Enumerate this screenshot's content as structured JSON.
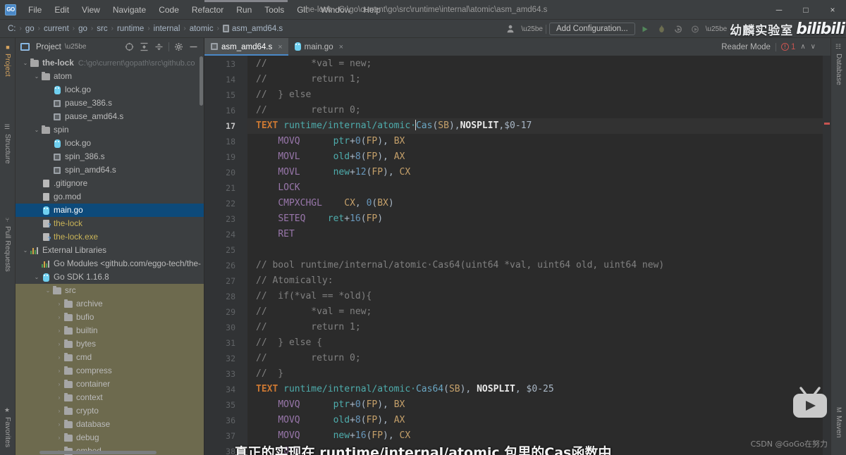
{
  "window": {
    "title": "the-lock - C:\\go\\current\\go\\src\\runtime\\internal\\atomic\\asm_amd64.s",
    "app_logo_text": "GO",
    "minimize": "─",
    "maximize": "□",
    "close": "×"
  },
  "menubar": {
    "items": [
      {
        "label": "File"
      },
      {
        "label": "Edit"
      },
      {
        "label": "View"
      },
      {
        "label": "Navigate"
      },
      {
        "label": "Code"
      },
      {
        "label": "Refactor"
      },
      {
        "label": "Run"
      },
      {
        "label": "Tools"
      },
      {
        "label": "Git"
      },
      {
        "label": "Window"
      },
      {
        "label": "Help"
      }
    ]
  },
  "navbar": {
    "breadcrumbs": [
      "C:",
      "go",
      "current",
      "go",
      "src",
      "runtime",
      "internal",
      "atomic",
      "asm_amd64.s"
    ],
    "separator": "›",
    "add_configuration": "Add Configuration...",
    "watermark_cn": "幼麟实验室",
    "bili_logo": "bilibili"
  },
  "left_strip": {
    "tools": [
      {
        "label": "Project",
        "active": true
      },
      {
        "label": "Structure",
        "active": false
      },
      {
        "label": "Pull Requests",
        "active": false
      },
      {
        "label": "Favorites",
        "active": false
      }
    ]
  },
  "right_strip": {
    "tools": [
      {
        "label": "Database"
      },
      {
        "label": "Maven"
      }
    ]
  },
  "project_panel": {
    "title": "Project",
    "tree": [
      {
        "indent": 0,
        "arrow": "⌄",
        "icon": "folder",
        "label": "the-lock",
        "sub": "C:\\go\\current\\gopath\\src\\github.co",
        "bold": true
      },
      {
        "indent": 1,
        "arrow": "⌄",
        "icon": "folder",
        "label": "atom"
      },
      {
        "indent": 2,
        "arrow": "",
        "icon": "gopher",
        "label": "lock.go"
      },
      {
        "indent": 2,
        "arrow": "",
        "icon": "asm",
        "label": "pause_386.s"
      },
      {
        "indent": 2,
        "arrow": "",
        "icon": "asm",
        "label": "pause_amd64.s"
      },
      {
        "indent": 1,
        "arrow": "⌄",
        "icon": "folder",
        "label": "spin"
      },
      {
        "indent": 2,
        "arrow": "",
        "icon": "gopher",
        "label": "lock.go"
      },
      {
        "indent": 2,
        "arrow": "",
        "icon": "asm",
        "label": "spin_386.s"
      },
      {
        "indent": 2,
        "arrow": "",
        "icon": "asm",
        "label": "spin_amd64.s"
      },
      {
        "indent": 1,
        "arrow": "",
        "icon": "file",
        "label": ".gitignore"
      },
      {
        "indent": 1,
        "arrow": "",
        "icon": "file",
        "label": "go.mod"
      },
      {
        "indent": 1,
        "arrow": "",
        "icon": "gopher",
        "label": "main.go",
        "selected": true
      },
      {
        "indent": 1,
        "arrow": "",
        "icon": "fileq",
        "label": "the-lock",
        "yellow": true
      },
      {
        "indent": 1,
        "arrow": "",
        "icon": "fileq",
        "label": "the-lock.exe",
        "yellow": true
      },
      {
        "indent": 0,
        "arrow": "⌄",
        "icon": "lib",
        "label": "External Libraries"
      },
      {
        "indent": 1,
        "arrow": "",
        "icon": "lib",
        "label": "Go Modules <github.com/eggo-tech/the-l"
      },
      {
        "indent": 1,
        "arrow": "⌄",
        "icon": "gopher",
        "label": "Go SDK 1.16.8"
      },
      {
        "indent": 2,
        "arrow": "⌄",
        "icon": "folder",
        "label": "src",
        "shaded": true
      },
      {
        "indent": 3,
        "arrow": "›",
        "icon": "folder",
        "label": "archive",
        "shaded": true
      },
      {
        "indent": 3,
        "arrow": "›",
        "icon": "folder",
        "label": "bufio",
        "shaded": true
      },
      {
        "indent": 3,
        "arrow": "›",
        "icon": "folder",
        "label": "builtin",
        "shaded": true
      },
      {
        "indent": 3,
        "arrow": "›",
        "icon": "folder",
        "label": "bytes",
        "shaded": true
      },
      {
        "indent": 3,
        "arrow": "›",
        "icon": "folder",
        "label": "cmd",
        "shaded": true
      },
      {
        "indent": 3,
        "arrow": "›",
        "icon": "folder",
        "label": "compress",
        "shaded": true
      },
      {
        "indent": 3,
        "arrow": "›",
        "icon": "folder",
        "label": "container",
        "shaded": true
      },
      {
        "indent": 3,
        "arrow": "›",
        "icon": "folder",
        "label": "context",
        "shaded": true
      },
      {
        "indent": 3,
        "arrow": "›",
        "icon": "folder",
        "label": "crypto",
        "shaded": true
      },
      {
        "indent": 3,
        "arrow": "›",
        "icon": "folder",
        "label": "database",
        "shaded": true
      },
      {
        "indent": 3,
        "arrow": "›",
        "icon": "folder",
        "label": "debug",
        "shaded": true
      },
      {
        "indent": 3,
        "arrow": "›",
        "icon": "folder",
        "label": "embed",
        "shaded": true
      }
    ]
  },
  "editor": {
    "tabs": [
      {
        "label": "asm_amd64.s",
        "icon": "asm-icon",
        "active": true,
        "close": "×"
      },
      {
        "label": "main.go",
        "icon": "gopher-icon",
        "active": false,
        "close": "×"
      }
    ],
    "reader_mode": "Reader Mode",
    "error_count": "1",
    "chevron_up": "∧",
    "chevron_down": "∨",
    "first_line_number": 13,
    "current_line": 17,
    "lines": [
      {
        "n": 13,
        "segs": [
          {
            "t": "//        *val = new;",
            "c": "cm"
          }
        ]
      },
      {
        "n": 14,
        "segs": [
          {
            "t": "//        return 1;",
            "c": "cm"
          }
        ]
      },
      {
        "n": 15,
        "segs": [
          {
            "t": "//  } else",
            "c": "cm"
          }
        ]
      },
      {
        "n": 16,
        "segs": [
          {
            "t": "//        return 0;",
            "c": "cm"
          }
        ]
      },
      {
        "n": 17,
        "cur": true,
        "segs": [
          {
            "t": "TEXT",
            "c": "kw-text"
          },
          {
            "t": " ",
            "c": "plain"
          },
          {
            "t": "runtime∕internal∕atomic·",
            "c": "sym"
          },
          {
            "t": "|",
            "c": "caret"
          },
          {
            "t": "Cas",
            "c": "fn"
          },
          {
            "t": "(",
            "c": "plain"
          },
          {
            "t": "SB",
            "c": "reg2"
          },
          {
            "t": "),",
            "c": "plain"
          },
          {
            "t": "NOSPLIT",
            "c": "bold-w"
          },
          {
            "t": ",",
            "c": "plain"
          },
          {
            "t": "$0-17",
            "c": "plain"
          }
        ]
      },
      {
        "n": 18,
        "segs": [
          {
            "t": "    ",
            "c": "plain"
          },
          {
            "t": "MOVQ",
            "c": "reg"
          },
          {
            "t": "      ",
            "c": "plain"
          },
          {
            "t": "ptr",
            "c": "ident"
          },
          {
            "t": "+",
            "c": "plain"
          },
          {
            "t": "0",
            "c": "num"
          },
          {
            "t": "(",
            "c": "plain"
          },
          {
            "t": "FP",
            "c": "reg2"
          },
          {
            "t": "), ",
            "c": "plain"
          },
          {
            "t": "BX",
            "c": "reg2"
          }
        ]
      },
      {
        "n": 19,
        "segs": [
          {
            "t": "    ",
            "c": "plain"
          },
          {
            "t": "MOVL",
            "c": "reg"
          },
          {
            "t": "      ",
            "c": "plain"
          },
          {
            "t": "old",
            "c": "ident"
          },
          {
            "t": "+",
            "c": "plain"
          },
          {
            "t": "8",
            "c": "num"
          },
          {
            "t": "(",
            "c": "plain"
          },
          {
            "t": "FP",
            "c": "reg2"
          },
          {
            "t": "), ",
            "c": "plain"
          },
          {
            "t": "AX",
            "c": "reg2"
          }
        ]
      },
      {
        "n": 20,
        "segs": [
          {
            "t": "    ",
            "c": "plain"
          },
          {
            "t": "MOVL",
            "c": "reg"
          },
          {
            "t": "      ",
            "c": "plain"
          },
          {
            "t": "new",
            "c": "ident"
          },
          {
            "t": "+",
            "c": "plain"
          },
          {
            "t": "12",
            "c": "num"
          },
          {
            "t": "(",
            "c": "plain"
          },
          {
            "t": "FP",
            "c": "reg2"
          },
          {
            "t": "), ",
            "c": "plain"
          },
          {
            "t": "CX",
            "c": "reg2"
          }
        ]
      },
      {
        "n": 21,
        "segs": [
          {
            "t": "    ",
            "c": "plain"
          },
          {
            "t": "LOCK",
            "c": "reg"
          }
        ]
      },
      {
        "n": 22,
        "segs": [
          {
            "t": "    ",
            "c": "plain"
          },
          {
            "t": "CMPXCHGL",
            "c": "reg"
          },
          {
            "t": "    ",
            "c": "plain"
          },
          {
            "t": "CX",
            "c": "reg2"
          },
          {
            "t": ", ",
            "c": "plain"
          },
          {
            "t": "0",
            "c": "num"
          },
          {
            "t": "(",
            "c": "plain"
          },
          {
            "t": "BX",
            "c": "reg2"
          },
          {
            "t": ")",
            "c": "plain"
          }
        ]
      },
      {
        "n": 23,
        "segs": [
          {
            "t": "    ",
            "c": "plain"
          },
          {
            "t": "SETEQ",
            "c": "reg"
          },
          {
            "t": "    ",
            "c": "plain"
          },
          {
            "t": "ret",
            "c": "ident"
          },
          {
            "t": "+",
            "c": "plain"
          },
          {
            "t": "16",
            "c": "num"
          },
          {
            "t": "(",
            "c": "plain"
          },
          {
            "t": "FP",
            "c": "reg2"
          },
          {
            "t": ")",
            "c": "plain"
          }
        ]
      },
      {
        "n": 24,
        "segs": [
          {
            "t": "    ",
            "c": "plain"
          },
          {
            "t": "RET",
            "c": "reg"
          }
        ]
      },
      {
        "n": 25,
        "segs": [
          {
            "t": "",
            "c": "plain"
          }
        ]
      },
      {
        "n": 26,
        "segs": [
          {
            "t": "// bool runtime∕internal∕atomic·Cas64(uint64 *val, uint64 old, uint64 new)",
            "c": "cm"
          }
        ]
      },
      {
        "n": 27,
        "segs": [
          {
            "t": "// Atomically:",
            "c": "cm"
          }
        ]
      },
      {
        "n": 28,
        "segs": [
          {
            "t": "//  if(*val == *old){",
            "c": "cm"
          }
        ]
      },
      {
        "n": 29,
        "segs": [
          {
            "t": "//        *val = new;",
            "c": "cm"
          }
        ]
      },
      {
        "n": 30,
        "segs": [
          {
            "t": "//        return 1;",
            "c": "cm"
          }
        ]
      },
      {
        "n": 31,
        "segs": [
          {
            "t": "//  } else {",
            "c": "cm"
          }
        ]
      },
      {
        "n": 32,
        "segs": [
          {
            "t": "//        return 0;",
            "c": "cm"
          }
        ]
      },
      {
        "n": 33,
        "segs": [
          {
            "t": "//  }",
            "c": "cm"
          }
        ]
      },
      {
        "n": 34,
        "segs": [
          {
            "t": "TEXT",
            "c": "kw-text"
          },
          {
            "t": " ",
            "c": "plain"
          },
          {
            "t": "runtime∕internal∕atomic·",
            "c": "sym"
          },
          {
            "t": "Cas64",
            "c": "fn"
          },
          {
            "t": "(",
            "c": "plain"
          },
          {
            "t": "SB",
            "c": "reg2"
          },
          {
            "t": "), ",
            "c": "plain"
          },
          {
            "t": "NOSPLIT",
            "c": "bold-w"
          },
          {
            "t": ", ",
            "c": "plain"
          },
          {
            "t": "$0-25",
            "c": "plain"
          }
        ]
      },
      {
        "n": 35,
        "segs": [
          {
            "t": "    ",
            "c": "plain"
          },
          {
            "t": "MOVQ",
            "c": "reg"
          },
          {
            "t": "      ",
            "c": "plain"
          },
          {
            "t": "ptr",
            "c": "ident"
          },
          {
            "t": "+",
            "c": "plain"
          },
          {
            "t": "0",
            "c": "num"
          },
          {
            "t": "(",
            "c": "plain"
          },
          {
            "t": "FP",
            "c": "reg2"
          },
          {
            "t": "), ",
            "c": "plain"
          },
          {
            "t": "BX",
            "c": "reg2"
          }
        ]
      },
      {
        "n": 36,
        "segs": [
          {
            "t": "    ",
            "c": "plain"
          },
          {
            "t": "MOVQ",
            "c": "reg"
          },
          {
            "t": "      ",
            "c": "plain"
          },
          {
            "t": "old",
            "c": "ident"
          },
          {
            "t": "+",
            "c": "plain"
          },
          {
            "t": "8",
            "c": "num"
          },
          {
            "t": "(",
            "c": "plain"
          },
          {
            "t": "FP",
            "c": "reg2"
          },
          {
            "t": "), ",
            "c": "plain"
          },
          {
            "t": "AX",
            "c": "reg2"
          }
        ]
      },
      {
        "n": 37,
        "segs": [
          {
            "t": "    ",
            "c": "plain"
          },
          {
            "t": "MOVQ",
            "c": "reg"
          },
          {
            "t": "      ",
            "c": "plain"
          },
          {
            "t": "new",
            "c": "ident"
          },
          {
            "t": "+",
            "c": "plain"
          },
          {
            "t": "16",
            "c": "num"
          },
          {
            "t": "(",
            "c": "plain"
          },
          {
            "t": "FP",
            "c": "reg2"
          },
          {
            "t": "), ",
            "c": "plain"
          },
          {
            "t": "CX",
            "c": "reg2"
          }
        ]
      },
      {
        "n": 38,
        "segs": [
          {
            "t": "    ",
            "c": "plain"
          },
          {
            "t": "LOCK",
            "c": "reg"
          }
        ]
      }
    ]
  },
  "overlays": {
    "subtitle_cn": "真正的实现在 runtime/internal/atomic 包里的Cas函数中",
    "csdn_watermark": "CSDN @GoGo在努力"
  },
  "colors": {
    "accent": "#4a88c7",
    "selection": "#0d4a7a",
    "editor_bg": "#2b2b2b",
    "panel_bg": "#3c3f41",
    "error": "#c75450",
    "keyword": "#cc7832",
    "symbol": "#4eadad",
    "register": "#9876aa",
    "comment": "#808080"
  }
}
